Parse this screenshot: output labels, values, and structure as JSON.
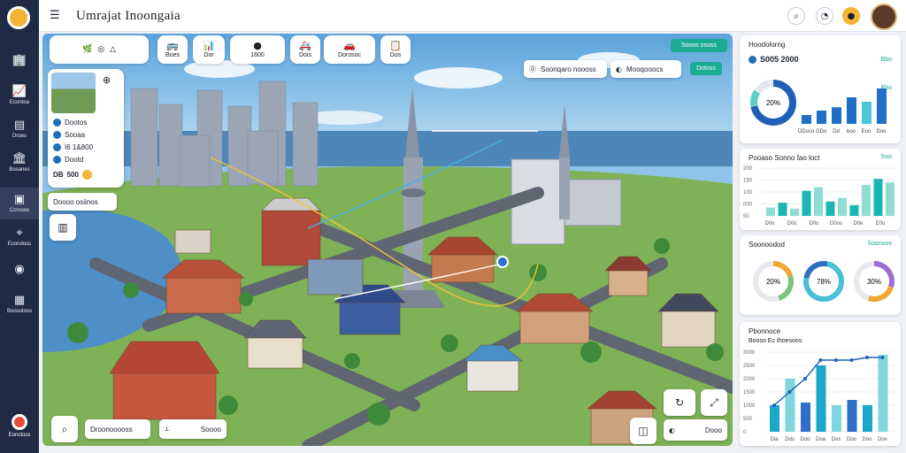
{
  "app": {
    "title": "Umrajat Inoongaia"
  },
  "sidebar": {
    "items": [
      {
        "label": "",
        "icon": "building-icon"
      },
      {
        "label": "Econtoa",
        "icon": "chart-icon"
      },
      {
        "label": "Droes",
        "icon": "document-icon"
      },
      {
        "label": "Bosanes",
        "icon": "bank-icon"
      },
      {
        "label": "Ccrcoos",
        "icon": "briefcase-icon"
      },
      {
        "label": "Econdoss",
        "icon": "pin-icon"
      },
      {
        "label": "",
        "icon": "coin-icon"
      },
      {
        "label": "Boosotoss",
        "icon": "grid-icon"
      }
    ],
    "bottom_label": "Eonctoss"
  },
  "topbar": {
    "icons": [
      "search-icon",
      "speedometer-icon",
      "coin-icon"
    ]
  },
  "map_toolbar": [
    {
      "icon": "leaf-icon",
      "label": "",
      "icon2": "binoculars-icon",
      "icon3": "bell-icon"
    },
    {
      "icon": "bus-icon",
      "label": "Boes"
    },
    {
      "icon": "chart-icon",
      "label": "Dor"
    },
    {
      "icon": "",
      "label": "1600"
    },
    {
      "icon": "ambulance-icon",
      "label": "Dois"
    },
    {
      "icon": "car-icon",
      "label": "Dorosoc"
    },
    {
      "icon": "clipboard-icon",
      "label": "Dos"
    }
  ],
  "info_card": {
    "rows": [
      {
        "text": "Dootos"
      },
      {
        "text": "Sooaa"
      },
      {
        "text": "I6  1&800"
      },
      {
        "text": "Dootd"
      }
    ],
    "price_prefix": "DB",
    "price": "500"
  },
  "map_overlay": {
    "search_pill": "Doooo osiinos",
    "tag_1": "Soonqaro noooss",
    "tag_2": "Mooqooocs",
    "button_top": "Sooos ososs",
    "button_mid": "Dotoss",
    "bottom_left_label": "Droonooooss",
    "bottom_mid_label": "Soooo",
    "bottom_right_label": "Dooo"
  },
  "panels": {
    "stats": {
      "title": "Hoodolorng",
      "value_line": "S005 2000",
      "badge": "Bbo",
      "badge2": "Bbo",
      "donut_label": "20%",
      "x_labels": [
        "DDoco",
        "GDo",
        "Dd",
        "boo",
        "Eoo",
        "Doo"
      ]
    },
    "area": {
      "title": "Pooaso Sonno fao loct",
      "badge": "Soo",
      "y_labels": [
        "200",
        "150",
        "100",
        "000",
        "50"
      ],
      "x_labels": [
        "D0o",
        "D0o",
        "D0o",
        "D0os",
        "D0e",
        "E0o"
      ]
    },
    "donuts": {
      "title": "Soonoodod",
      "badge": "Soonoos",
      "labels": [
        "20%",
        "78%",
        "30%"
      ]
    },
    "combo": {
      "title": "Pbonnoce",
      "subtitle": "Booso Ec Ihoesoos",
      "y_labels": [
        "3000",
        "2500",
        "2000",
        "1500",
        "1000",
        "500",
        "0"
      ],
      "x_labels": [
        "Dia",
        "Dds",
        "Doo",
        "Doa",
        "Dos",
        "Doo",
        "Doo",
        "Dov"
      ]
    }
  },
  "chart_data": [
    {
      "type": "bar",
      "categories": [
        "DDoco",
        "GDo",
        "Dd",
        "boo",
        "Eoo",
        "Doo"
      ],
      "values": [
        8,
        12,
        15,
        24,
        20,
        32
      ],
      "title": "Hoodolorng"
    },
    {
      "type": "bar",
      "title": "Pooaso Sonno fao loct",
      "categories": [
        "D0o",
        "D0o",
        "D0o",
        "D0os",
        "D0e",
        "E0o"
      ],
      "values": [
        35,
        55,
        30,
        105,
        120,
        60,
        75,
        45,
        130,
        155,
        140
      ],
      "ylim": [
        0,
        200
      ]
    },
    {
      "type": "pie",
      "title": "Soonoodod",
      "values": [
        20,
        78,
        30
      ],
      "labels": [
        "20%",
        "78%",
        "30%"
      ]
    },
    {
      "type": "bar",
      "title": "Pbonnoce",
      "categories": [
        "Dia",
        "Dds",
        "Doo",
        "Doa",
        "Dos",
        "Doo",
        "Doo",
        "Dov"
      ],
      "values": [
        1000,
        2000,
        1100,
        2500,
        1000,
        1200,
        1000,
        2900
      ],
      "line": [
        1000,
        1500,
        2000,
        2700,
        2700,
        2700,
        2800,
        2800
      ],
      "ylim": [
        0,
        3000
      ]
    }
  ]
}
